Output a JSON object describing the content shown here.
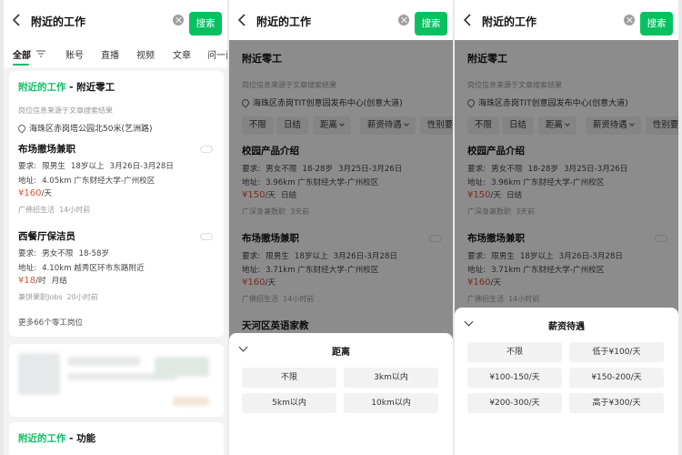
{
  "search": {
    "query": "附近的工作",
    "button": "搜索"
  },
  "tabs": [
    {
      "label": "全部"
    },
    {
      "label": "账号"
    },
    {
      "label": "直播"
    },
    {
      "label": "视频"
    },
    {
      "label": "文章"
    },
    {
      "label": "问一问"
    }
  ],
  "panel1": {
    "card_title_highlight": "附近的工作",
    "card_title_rest": " - 附近零工",
    "note": "岗位信息来源于文章搜索结果",
    "location": "海珠区赤岗塔公园北50米(艺洲路)",
    "jobs": [
      {
        "title": "布场撤场兼职",
        "req_label": "要求:",
        "req": [
          "限男生",
          "18岁以上",
          "3月26日-3月28日"
        ],
        "addr_label": "地址:",
        "addr": "4.05km 广东财经大学-广州校区",
        "price": "¥160",
        "unit": "/天",
        "tag": "",
        "source": "广佛招生活",
        "time": "14小时前"
      },
      {
        "title": "西餐厅保洁员",
        "req_label": "要求:",
        "req": [
          "男女不限",
          "18-58岁"
        ],
        "addr_label": "地址:",
        "addr": "4.10km 越秀区环市东路附近",
        "price": "¥18",
        "unit": "/时",
        "tag": "月结",
        "source": "兼饼果职Jobs",
        "time": "20小时前"
      }
    ],
    "more": "更多66个零工岗位",
    "card2_title_highlight": "附近的工作",
    "card2_title_rest": " - 功能"
  },
  "panel2": {
    "title": "附近零工",
    "note": "岗位信息来源于文章搜索结果",
    "location": "海珠区赤岗TIT创意园发布中心(创意大道)",
    "chips": [
      "不限",
      "日结",
      "距离",
      "薪资待遇",
      "性别要"
    ],
    "jobs": [
      {
        "title": "校园产品介绍",
        "req_label": "要求:",
        "req": [
          "男女不限",
          "18-28岁",
          "3月25日-3月26日"
        ],
        "addr_label": "地址:",
        "addr": "3.96km 广东财经大学-广州校区",
        "price": "¥150",
        "unit": "/天",
        "tag": "日结",
        "source": "广深身兼数职",
        "time": "3天前"
      },
      {
        "title": "布场撤场兼职",
        "req_label": "要求:",
        "req": [
          "限男生",
          "18岁以上",
          "3月26日-3月28日"
        ],
        "addr_label": "地址:",
        "addr": "3.71km 广东财经大学-广州校区",
        "price": "¥160",
        "unit": "/天",
        "tag": "",
        "source": "广佛招生活",
        "time": "14小时前"
      },
      {
        "title": "天河区英语家教"
      }
    ],
    "sheet": {
      "title": "距离",
      "options": [
        "不限",
        "3km以内",
        "5km以内",
        "10km以内"
      ]
    }
  },
  "panel3": {
    "title": "附近零工",
    "note": "岗位信息来源于文章搜索结果",
    "location": "海珠区赤岗TIT创意园发布中心(创意大道)",
    "chips": [
      "不限",
      "日结",
      "距离",
      "薪资待遇",
      "性别要"
    ],
    "jobs": [
      {
        "title": "校园产品介绍",
        "req_label": "要求:",
        "req": [
          "男女不限",
          "18-28岁",
          "3月25日-3月26日"
        ],
        "addr_label": "地址:",
        "addr": "3.96km 广东财经大学-广州校区",
        "price": "¥150",
        "unit": "/天",
        "tag": "日结",
        "source": "广深身兼数职",
        "time": "3天前"
      },
      {
        "title": "布场撤场兼职",
        "req_label": "要求:",
        "req": [
          "限男生",
          "18岁以上",
          "3月26日-3月28日"
        ],
        "addr_label": "地址:",
        "addr": "3.71km 广东财经大学-广州校区",
        "price": "¥160",
        "unit": "/天",
        "tag": "",
        "source": "广佛招生活",
        "time": "14小时前"
      }
    ],
    "sheet": {
      "title": "薪资待遇",
      "options": [
        "不限",
        "低于¥100/天",
        "¥100-150/天",
        "¥150-200/天",
        "¥200-300/天",
        "高于¥300/天"
      ]
    }
  },
  "colors": {
    "accent": "#07c160",
    "price": "#e0533a"
  }
}
